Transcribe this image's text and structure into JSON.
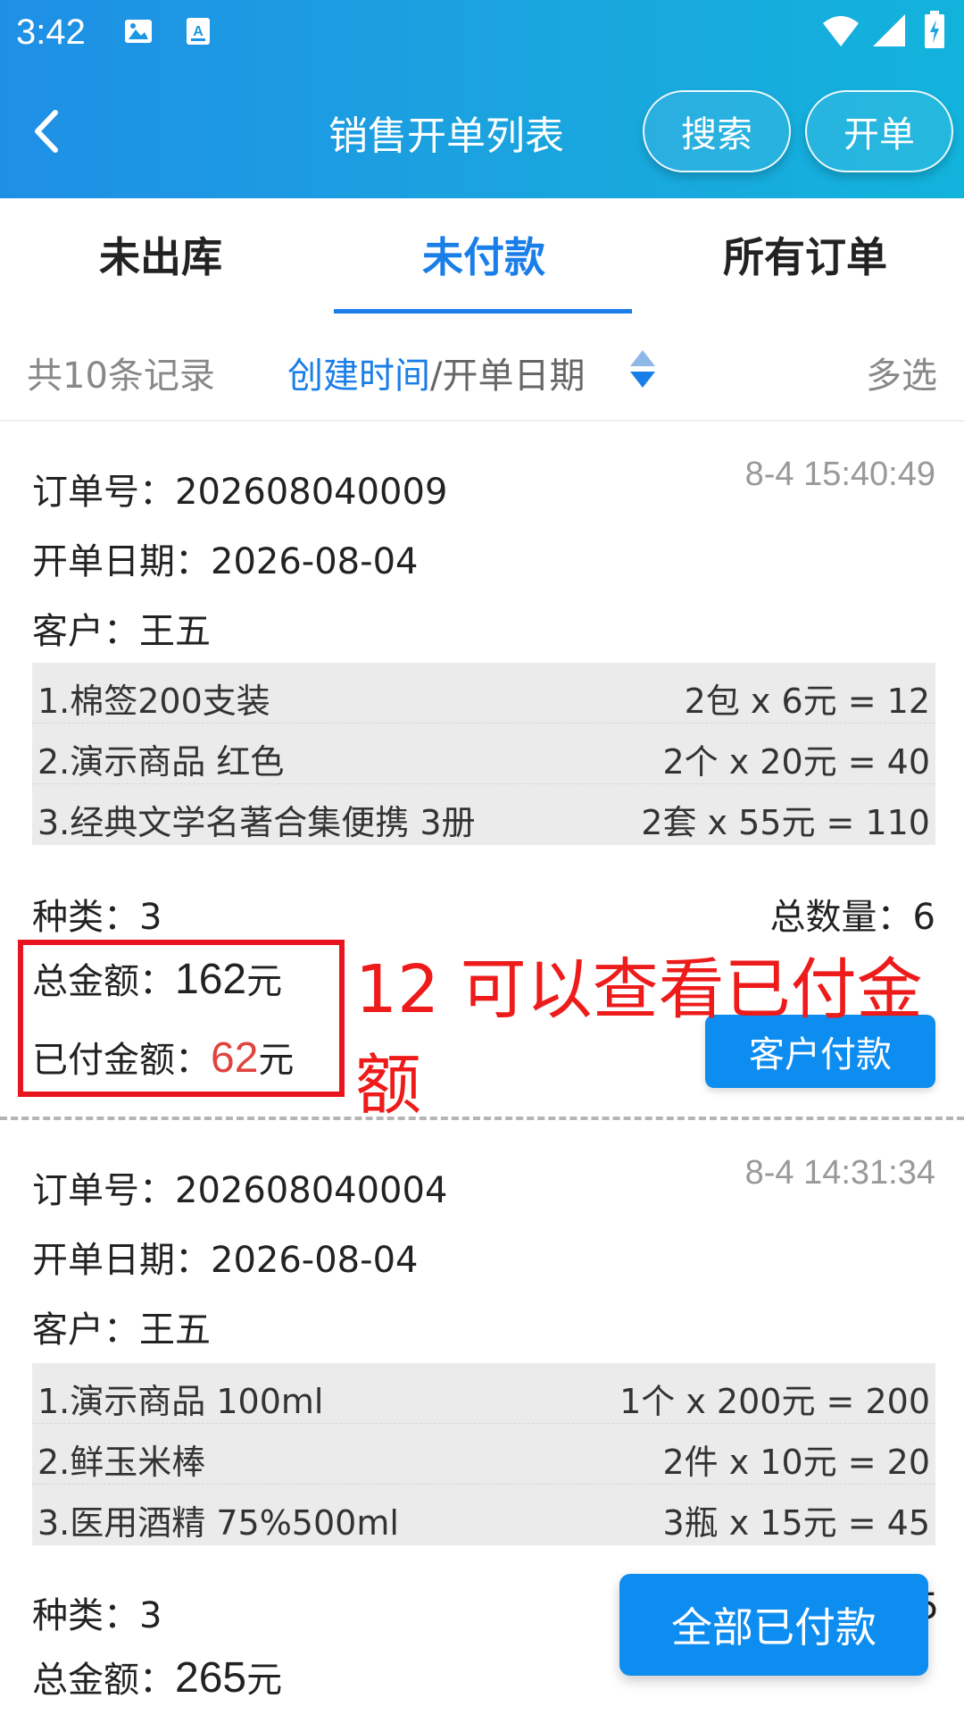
{
  "status_bar": {
    "time": "3:42"
  },
  "header": {
    "title": "销售开单列表",
    "search_label": "搜索",
    "create_label": "开单"
  },
  "tabs": [
    {
      "label": "未出库",
      "active": false
    },
    {
      "label": "未付款",
      "active": true
    },
    {
      "label": "所有订单",
      "active": false
    }
  ],
  "filter": {
    "count_text": "共10条记录",
    "sort_active": "创建时间",
    "sort_sep": "/",
    "sort_other": "开单日期",
    "multi_label": "多选"
  },
  "orders": [
    {
      "order_no_label": "订单号：",
      "order_no": "202608040009",
      "time": "8-4 15:40:49",
      "date_label": "开单日期：",
      "date": "2026-08-04",
      "customer_label": "客户：",
      "customer": "王五",
      "items": [
        {
          "name": "1.棉签200支装",
          "calc": "2包 x 6元 = 12"
        },
        {
          "name": "2.演示商品 红色",
          "calc": "2个 x 20元 = 40"
        },
        {
          "name": "3.经典文学名著合集便携 3册",
          "calc": "2套 x 55元 = 110"
        }
      ],
      "kinds_label": "种类：",
      "kinds": "3",
      "qty_label": "总数量：",
      "qty": "6",
      "total_label": "总金额：",
      "total": "162",
      "unit": "元",
      "paid_label": "已付金额：",
      "paid": "62",
      "pay_button": "客户付款"
    },
    {
      "order_no_label": "订单号：",
      "order_no": "202608040004",
      "time": "8-4 14:31:34",
      "date_label": "开单日期：",
      "date": "2026-08-04",
      "customer_label": "客户：",
      "customer": "王五",
      "items": [
        {
          "name": "1.演示商品 100ml",
          "calc": "1个 x 200元 = 200"
        },
        {
          "name": "2.鲜玉米棒",
          "calc": "2件 x 10元 = 20"
        },
        {
          "name": "3.医用酒精 75%500ml",
          "calc": "3瓶 x 15元 = 45"
        }
      ],
      "kinds_label": "种类：",
      "kinds": "3",
      "qty_partial": "5",
      "total_label": "总金额：",
      "total": "265",
      "unit": "元"
    }
  ],
  "annotation": "12 可以查看已付金额",
  "float_button": "全部已付款",
  "colors": {
    "primary": "#1a7ee8",
    "button": "#0e8df0",
    "paid_amount": "#e0443e",
    "annotation": "#ee1b1b"
  }
}
